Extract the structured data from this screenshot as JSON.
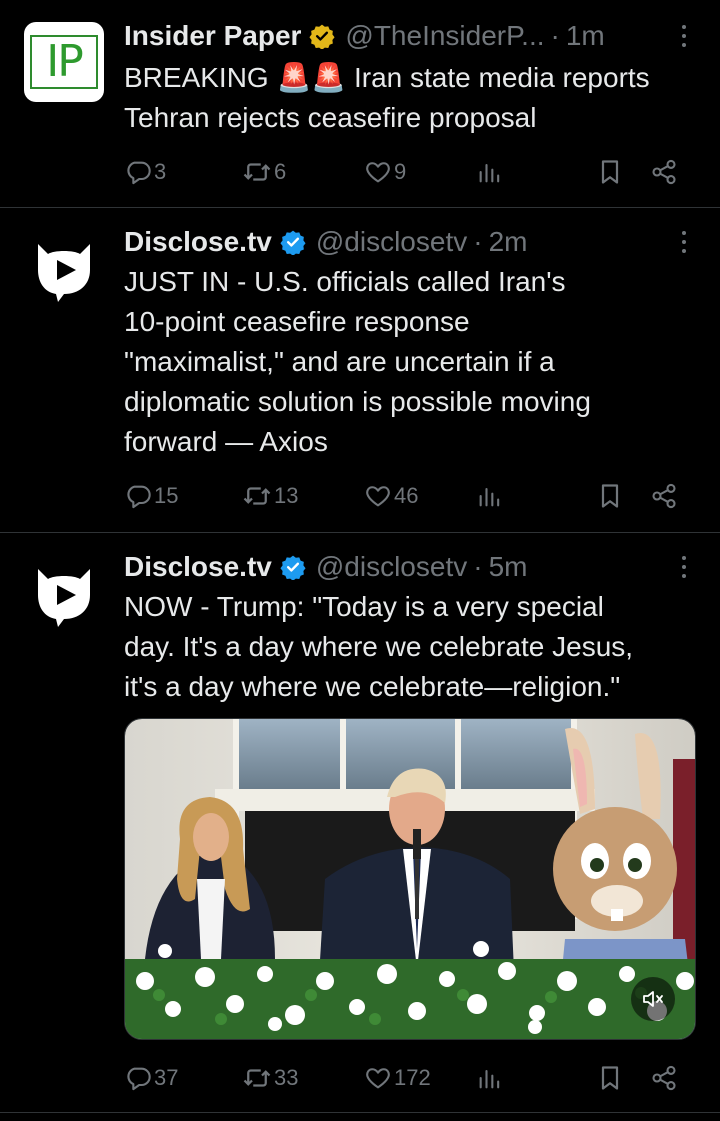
{
  "tweets": [
    {
      "name": "Insider Paper",
      "handle": "@TheInsiderP...",
      "dot": "·",
      "time": "1m",
      "badge": "gold",
      "avatar_text": "IP",
      "text": "BREAKING 🚨🚨 Iran state media reports\nTehran rejects ceasefire proposal",
      "replies": "3",
      "reposts": "6",
      "likes": "9"
    },
    {
      "name": "Disclose.tv",
      "handle": "@disclosetv",
      "dot": "·",
      "time": "2m",
      "badge": "blue",
      "text": "JUST IN - U.S. officials called Iran's\n10-point ceasefire response\n\"maximalist,\" and are uncertain if a\ndiplomatic solution is possible moving\nforward — Axios",
      "replies": "15",
      "reposts": "13",
      "likes": "46"
    },
    {
      "name": "Disclose.tv",
      "handle": "@disclosetv",
      "dot": "·",
      "time": "5m",
      "badge": "blue",
      "text": "NOW - Trump: \"Today is a very special\nday. It's a day where we celebrate Jesus,\nit's a day where we celebrate—religion.\"",
      "replies": "37",
      "reposts": "33",
      "likes": "172",
      "media": "video"
    }
  ],
  "colors": {
    "background": "#000000",
    "text": "#e7e9ea",
    "muted": "#71767b",
    "divider": "#2f3336",
    "verified_blue": "#1d9bf0",
    "verified_gold": "#e2b719",
    "ip_green": "#2e9a2e"
  },
  "icons": [
    "reply-icon",
    "repost-icon",
    "like-icon",
    "views-icon",
    "bookmark-icon",
    "share-icon",
    "more-icon",
    "mute-icon"
  ]
}
